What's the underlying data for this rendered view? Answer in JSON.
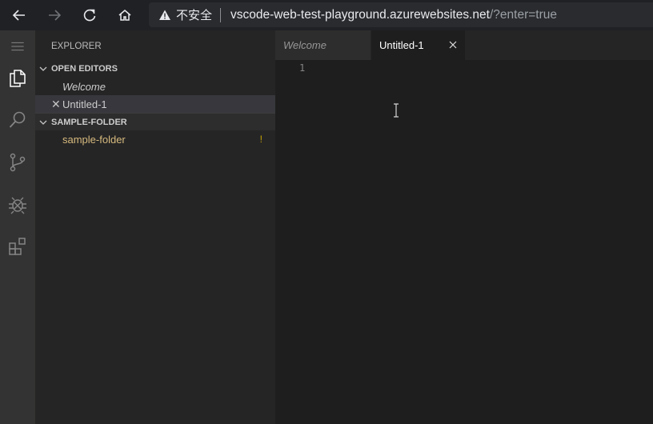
{
  "browser": {
    "security_label": "不安全",
    "url_host": "vscode-web-test-playground.azurewebsites.net",
    "url_rest": "/?enter=true",
    "icons": [
      "back-icon",
      "forward-icon",
      "reload-icon",
      "home-icon",
      "warning-icon"
    ]
  },
  "activity_bar": {
    "icons": [
      "menu-icon",
      "explorer-icon",
      "search-icon",
      "source-control-icon",
      "debug-icon",
      "extensions-icon"
    ]
  },
  "sidebar": {
    "title": "EXPLORER",
    "open_editors": {
      "header": "OPEN EDITORS",
      "items": [
        {
          "label": "Welcome",
          "italic": true
        },
        {
          "label": "Untitled-1",
          "close": "✕"
        }
      ]
    },
    "folder": {
      "header": "SAMPLE-FOLDER",
      "items": [
        {
          "label": "sample-folder",
          "badge": "!"
        }
      ]
    }
  },
  "tabs": [
    {
      "label": "Welcome",
      "active": false
    },
    {
      "label": "Untitled-1",
      "active": true
    }
  ],
  "editor": {
    "line_numbers": [
      "1"
    ]
  },
  "colors": {
    "activity_bar": "#333333",
    "sidebar": "#252526",
    "editor": "#1e1e1e",
    "folder_text": "#d7ba7d",
    "badge": "#cca700"
  }
}
